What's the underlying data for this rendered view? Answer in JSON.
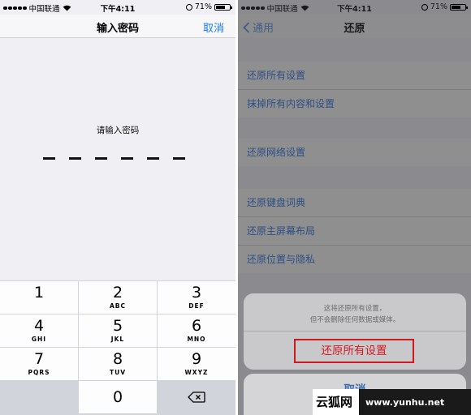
{
  "left": {
    "status": {
      "carrier": "中国联通",
      "time": "下午4:11",
      "battery": "71%",
      "battery_level": 0.71
    },
    "nav": {
      "title": "输入密码",
      "cancel": "取消"
    },
    "prompt": "请输入密码",
    "passcode_length": 6,
    "keypad": [
      {
        "num": "1",
        "letters": ""
      },
      {
        "num": "2",
        "letters": "ABC"
      },
      {
        "num": "3",
        "letters": "DEF"
      },
      {
        "num": "4",
        "letters": "GHI"
      },
      {
        "num": "5",
        "letters": "JKL"
      },
      {
        "num": "6",
        "letters": "MNO"
      },
      {
        "num": "7",
        "letters": "PQRS"
      },
      {
        "num": "8",
        "letters": "TUV"
      },
      {
        "num": "9",
        "letters": "WXYZ"
      },
      {
        "num": "0",
        "letters": ""
      }
    ],
    "delete_icon": "backspace-icon"
  },
  "right": {
    "status": {
      "carrier": "中国联通",
      "time": "下午4:11",
      "battery": "71%",
      "battery_level": 0.71
    },
    "nav": {
      "back": "通用",
      "title": "还原"
    },
    "groups": [
      [
        "还原所有设置",
        "抹掉所有内容和设置"
      ],
      [
        "还原网络设置"
      ],
      [
        "还原键盘词典",
        "还原主屏幕布局",
        "还原位置与隐私"
      ]
    ],
    "sheet": {
      "message_line1": "这将还原所有设置，",
      "message_line2": "但不会删除任何数据或媒体。",
      "confirm": "还原所有设置",
      "cancel": "取消"
    }
  },
  "watermark": {
    "brand": "云狐网",
    "url": "www.yunhu.net"
  },
  "colors": {
    "ios_blue": "#1a7cf5",
    "destructive_red": "#d0191f",
    "dimmed_link": "#2c4e85"
  }
}
